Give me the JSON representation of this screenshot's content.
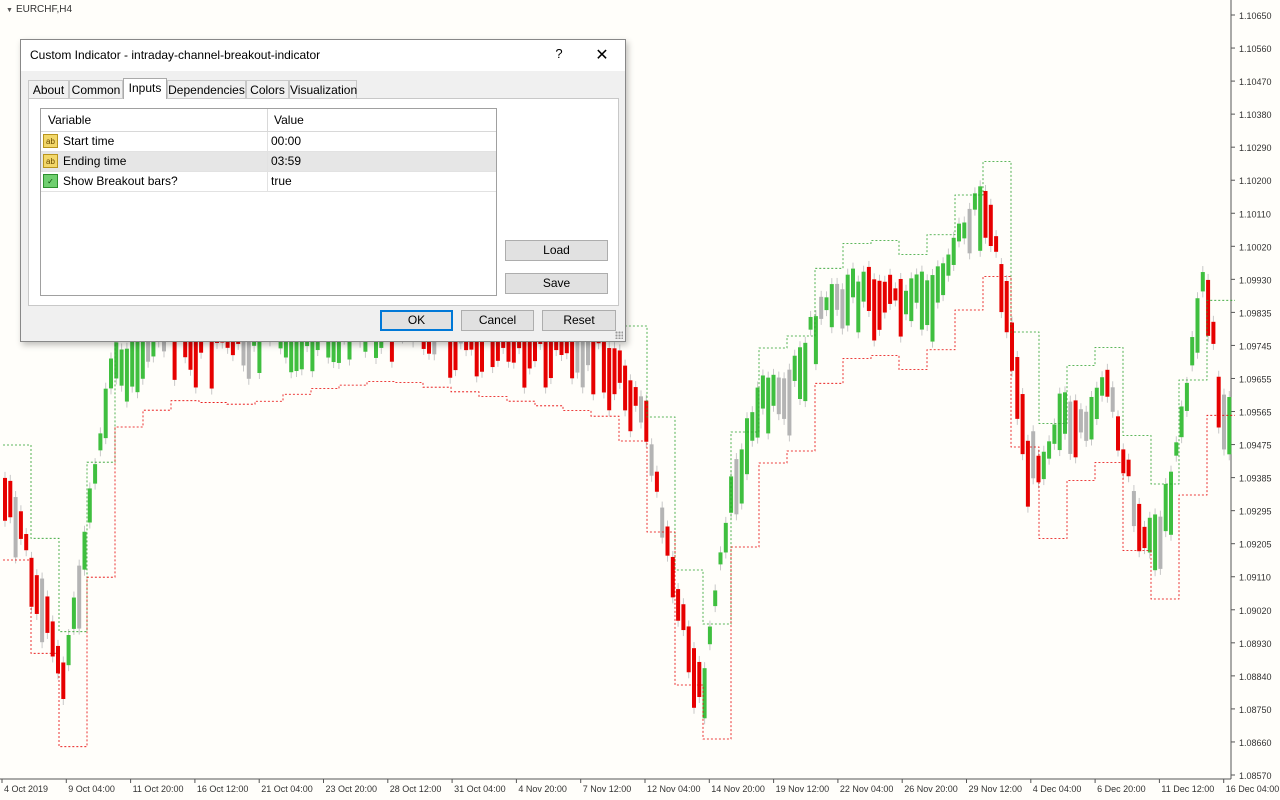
{
  "chart": {
    "symbol": "EURCHF,H4",
    "price_levels": [
      "1.10650",
      "1.10560",
      "1.10470",
      "1.10380",
      "1.10290",
      "1.10200",
      "1.10110",
      "1.10020",
      "1.09930",
      "1.09835",
      "1.09745",
      "1.09655",
      "1.09565",
      "1.09475",
      "1.09385",
      "1.09295",
      "1.09205",
      "1.09110",
      "1.09020",
      "1.08930",
      "1.08840",
      "1.08750",
      "1.08660",
      "1.08570"
    ],
    "time_labels": [
      "4 Oct 2019",
      "9 Oct 04:00",
      "11 Oct 20:00",
      "16 Oct 12:00",
      "21 Oct 04:00",
      "23 Oct 20:00",
      "28 Oct 12:00",
      "31 Oct 04:00",
      "4 Nov 20:00",
      "7 Nov 12:00",
      "12 Nov 04:00",
      "14 Nov 20:00",
      "19 Nov 12:00",
      "22 Nov 04:00",
      "26 Nov 20:00",
      "29 Nov 12:00",
      "4 Dec 04:00",
      "6 Dec 20:00",
      "11 Dec 12:00",
      "16 Dec 04:00"
    ],
    "colors": {
      "bull": "#3fbf3f",
      "bear": "#e60000",
      "neutral": "#b4b4b4",
      "grid_text": "#333333",
      "channel_upper": "#2aa02a",
      "channel_lower": "#e60000"
    }
  },
  "dialog": {
    "title": "Custom Indicator - intraday-channel-breakout-indicator",
    "help_icon": "?",
    "close_icon": "✕",
    "tabs": [
      {
        "label": "About",
        "active": false
      },
      {
        "label": "Common",
        "active": false
      },
      {
        "label": "Inputs",
        "active": true
      },
      {
        "label": "Dependencies",
        "active": false
      },
      {
        "label": "Colors",
        "active": false
      },
      {
        "label": "Visualization",
        "active": false
      }
    ],
    "inputs": {
      "col_variable": "Variable",
      "col_value": "Value",
      "rows": [
        {
          "icon": "string-param-icon",
          "icon_text": "ab",
          "variable": "Start time",
          "value": "00:00",
          "selected": false
        },
        {
          "icon": "string-param-icon",
          "icon_text": "ab",
          "variable": "Ending time",
          "value": "03:59",
          "selected": true
        },
        {
          "icon": "bool-param-icon",
          "icon_text": "✓",
          "variable": "Show Breakout bars?",
          "value": "true",
          "selected": false
        }
      ]
    },
    "buttons": {
      "load": "Load",
      "save": "Save",
      "ok": "OK",
      "cancel": "Cancel",
      "reset": "Reset"
    }
  }
}
